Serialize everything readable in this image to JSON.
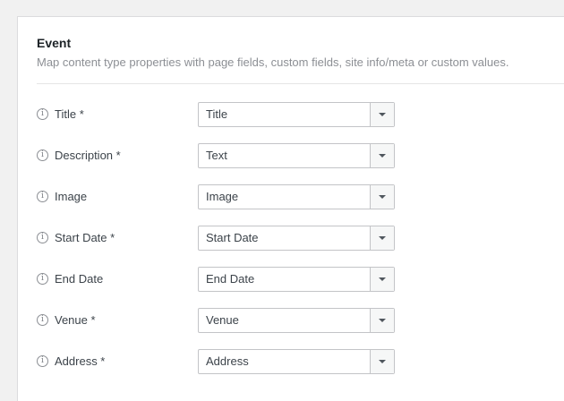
{
  "section": {
    "title": "Event",
    "description": "Map content type properties with page fields, custom fields, site info/meta or custom values."
  },
  "fields": [
    {
      "label": "Title *",
      "value": "Title",
      "icon": "info-icon"
    },
    {
      "label": "Description *",
      "value": "Text",
      "icon": "info-icon"
    },
    {
      "label": "Image",
      "value": "Image",
      "icon": "info-icon"
    },
    {
      "label": "Start Date *",
      "value": "Start Date",
      "icon": "info-icon"
    },
    {
      "label": "End Date",
      "value": "End Date",
      "icon": "info-icon"
    },
    {
      "label": "Venue *",
      "value": "Venue",
      "icon": "info-icon"
    },
    {
      "label": "Address *",
      "value": "Address",
      "icon": "info-icon"
    }
  ],
  "info_glyph": "i",
  "colors": {
    "background": "#f1f1f1",
    "panel": "#ffffff",
    "border": "#c3c4c7",
    "muted_text": "#8c8f94"
  }
}
